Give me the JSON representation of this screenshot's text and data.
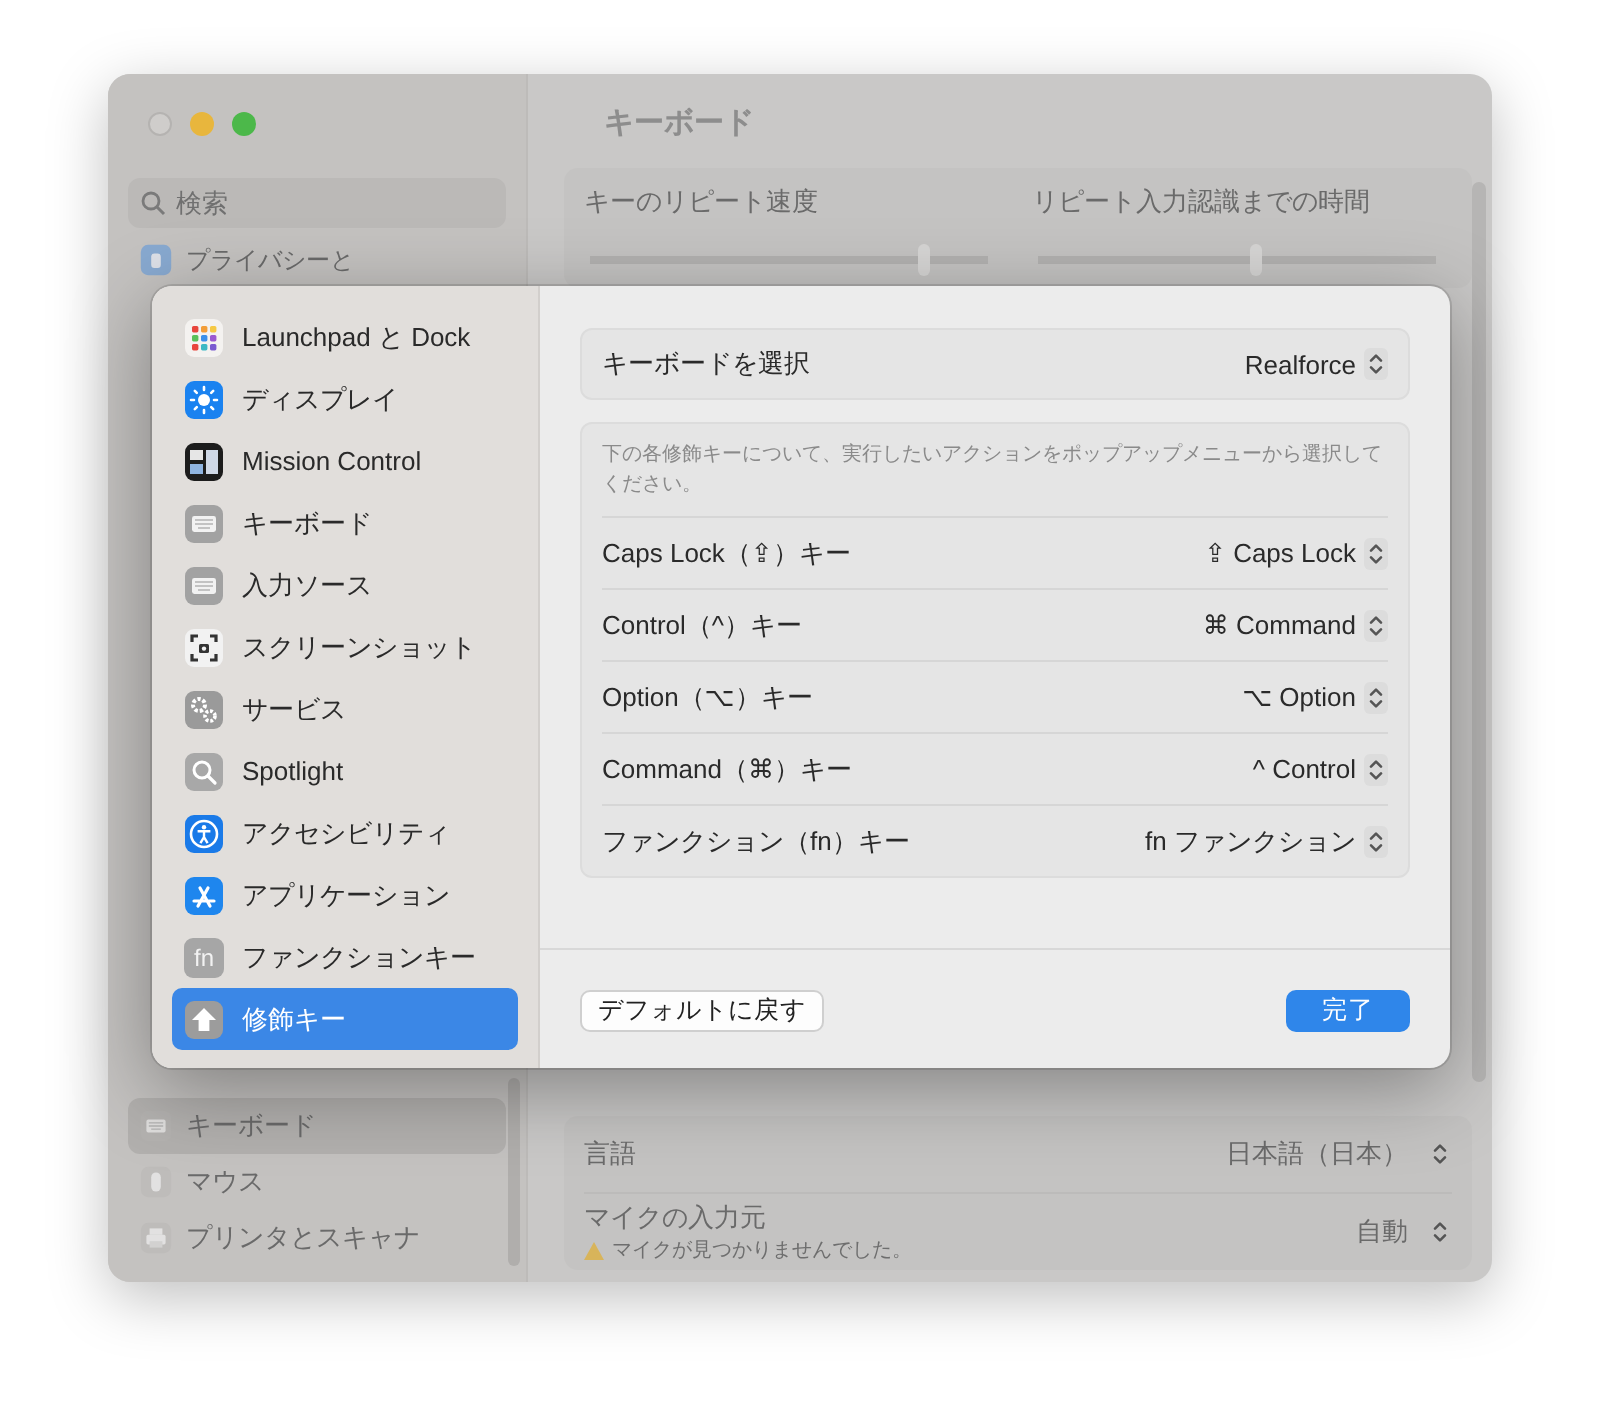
{
  "background_window": {
    "title": "キーボード",
    "search": {
      "placeholder": "検索"
    },
    "sidebar_top": [
      {
        "label": "プライバシーと",
        "kind": "privacy"
      }
    ],
    "sidebar_bottom": [
      {
        "label": "キーボード",
        "kind": "keyboard",
        "selected": true
      },
      {
        "label": "マウス",
        "kind": "mouse",
        "selected": false
      },
      {
        "label": "プリンタとスキャナ",
        "kind": "printer",
        "selected": false
      }
    ],
    "sliders": [
      {
        "label": "キーのリピート速度",
        "level": 0.84
      },
      {
        "label": "リピート入力認識までの時間",
        "level": 0.55
      }
    ],
    "rows": [
      {
        "label": "言語",
        "value": "日本語（日本）"
      },
      {
        "label": "マイクの入力元",
        "value": "自動",
        "warning": "マイクが見つかりませんでした。"
      }
    ]
  },
  "sheet": {
    "sidebar": [
      {
        "label": "Launchpad と Dock",
        "kind": "launchpad",
        "selected": false
      },
      {
        "label": "ディスプレイ",
        "kind": "display",
        "selected": false
      },
      {
        "label": "Mission Control",
        "kind": "mission",
        "selected": false
      },
      {
        "label": "キーボード",
        "kind": "keyboard",
        "selected": false
      },
      {
        "label": "入力ソース",
        "kind": "keyboard",
        "selected": false
      },
      {
        "label": "スクリーンショット",
        "kind": "screenshot",
        "selected": false
      },
      {
        "label": "サービス",
        "kind": "services",
        "selected": false
      },
      {
        "label": "Spotlight",
        "kind": "spotlight",
        "selected": false
      },
      {
        "label": "アクセシビリティ",
        "kind": "accessibility",
        "selected": false
      },
      {
        "label": "アプリケーション",
        "kind": "apps",
        "selected": false
      },
      {
        "label": "ファンクションキー",
        "kind": "fn",
        "icon_text": "fn",
        "selected": false
      },
      {
        "label": "修飾キー",
        "kind": "modifier",
        "selected": true
      }
    ],
    "keyboard_select": {
      "label": "キーボードを選択",
      "value": "Realforce"
    },
    "description": "下の各修飾キーについて、実行したいアクションをポップアップメニューから選択してください。",
    "modifier_keys": [
      {
        "label": "Caps Lock（⇪）キー",
        "value": "⇪ Caps Lock"
      },
      {
        "label": "Control（^）キー",
        "value": "⌘ Command"
      },
      {
        "label": "Option（⌥）キー",
        "value": "⌥ Option"
      },
      {
        "label": "Command（⌘）キー",
        "value": "^ Control"
      },
      {
        "label": "ファンクション（fn）キー",
        "value": "fn ファンクション"
      }
    ],
    "buttons": [
      {
        "label": "デフォルトに戻す",
        "kind": "secondary"
      },
      {
        "label": "完了",
        "kind": "primary"
      }
    ]
  }
}
